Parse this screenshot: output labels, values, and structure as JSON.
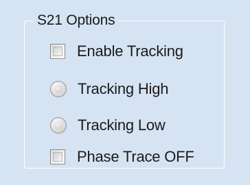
{
  "group": {
    "title": "S21 Options"
  },
  "options": [
    {
      "type": "checkbox",
      "label": "Enable Tracking",
      "checked": false
    },
    {
      "type": "radio",
      "label": "Tracking High",
      "checked": false
    },
    {
      "type": "radio",
      "label": "Tracking Low",
      "checked": false
    },
    {
      "type": "checkbox",
      "label": "Phase Trace OFF",
      "checked": false
    }
  ],
  "colors": {
    "background": "#d6e3f3",
    "group_border": "#ffffff",
    "text": "#1a1a1a"
  }
}
